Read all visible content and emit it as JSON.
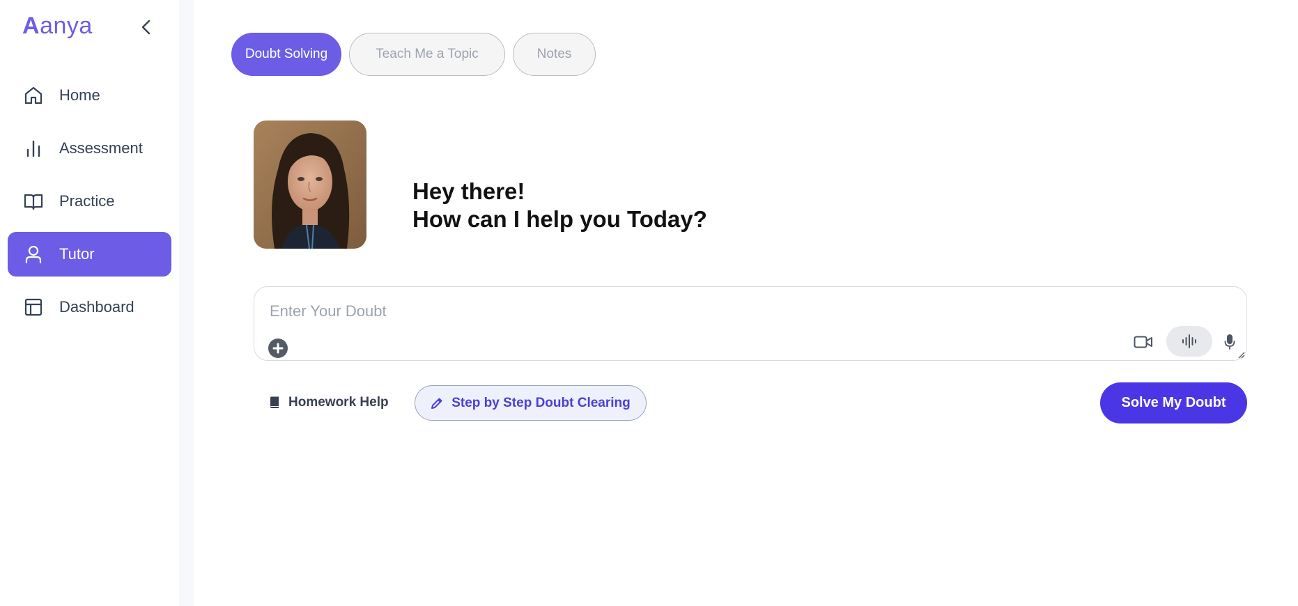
{
  "sidebar": {
    "logo_first": "A",
    "logo_rest": "anya",
    "collapse_icon": "chevron-left-icon",
    "items": [
      {
        "label": "Home",
        "icon": "home-icon",
        "active": false
      },
      {
        "label": "Assessment",
        "icon": "bar-chart-icon",
        "active": false
      },
      {
        "label": "Practice",
        "icon": "book-open-icon",
        "active": false
      },
      {
        "label": "Tutor",
        "icon": "user-icon",
        "active": true
      },
      {
        "label": "Dashboard",
        "icon": "layout-icon",
        "active": false
      }
    ]
  },
  "main": {
    "tabs": [
      {
        "label": "Doubt Solving",
        "active": true
      },
      {
        "label": "Teach Me a Topic",
        "active": false
      },
      {
        "label": "Notes",
        "active": false
      }
    ],
    "greeting": {
      "line1": "Hey there!",
      "line2": "How can I help you Today?"
    },
    "doubt": {
      "placeholder": "Enter Your Doubt",
      "value": ""
    },
    "actions": {
      "homework_label": "Homework Help",
      "step_label": "Step by Step Doubt Clearing",
      "solve_label": "Solve My Doubt"
    }
  },
  "colors": {
    "accent": "#6d5ce6",
    "solve_button": "#4b36e6",
    "step_text": "#4b3fd6"
  }
}
